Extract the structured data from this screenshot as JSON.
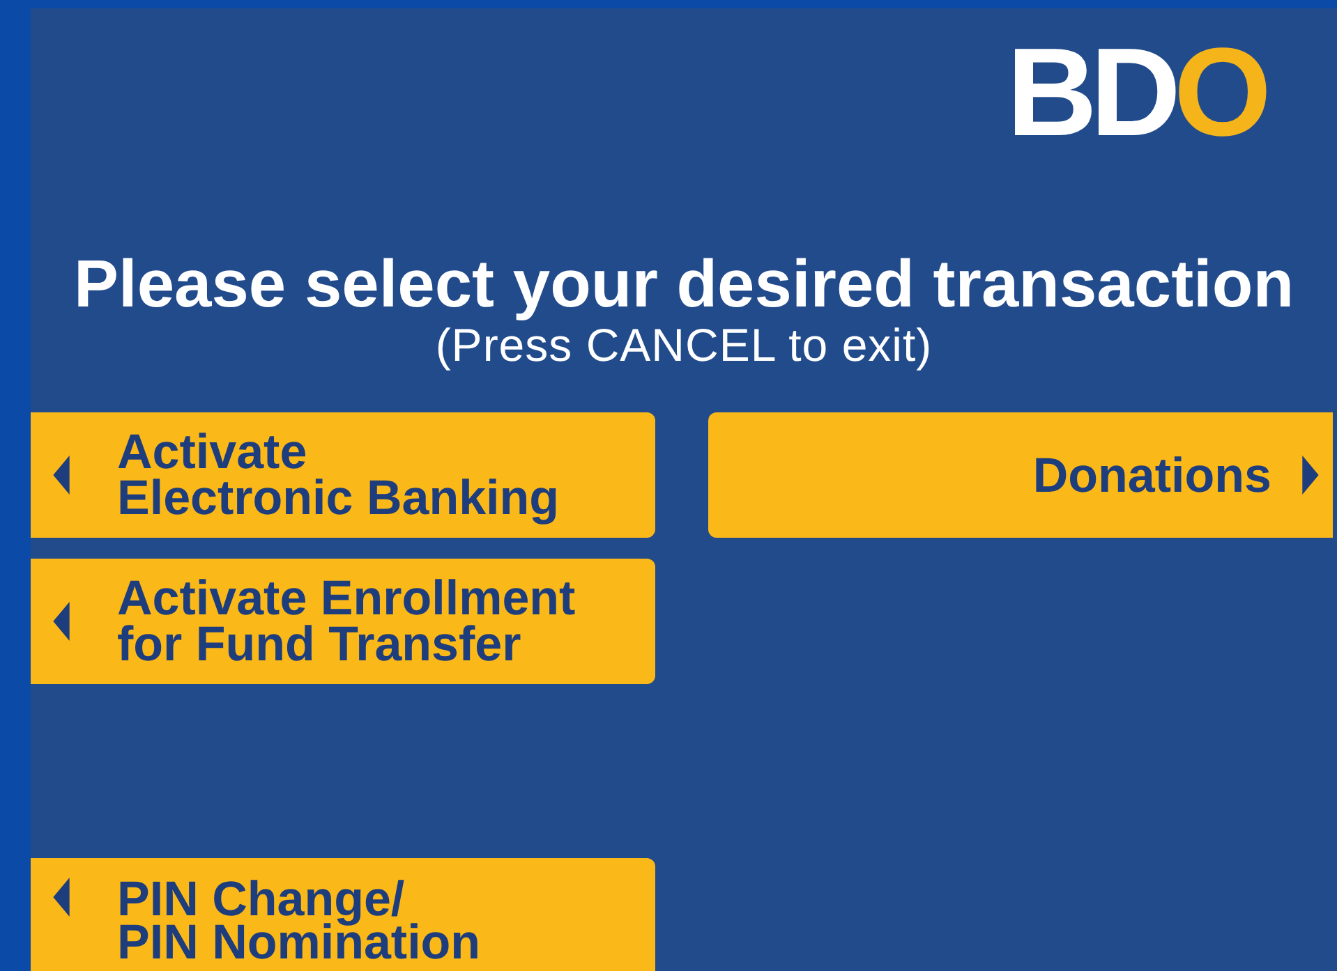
{
  "logo": {
    "white_part": "BD",
    "gold_part": "O"
  },
  "heading": {
    "title": "Please select your desired transaction",
    "subtitle": "(Press CANCEL to exit)"
  },
  "left_options": [
    {
      "label": "Activate\nElectronic Banking",
      "kind": "left-arrow"
    },
    {
      "label": "Activate Enrollment\nfor Fund Transfer",
      "kind": "left-arrow"
    },
    {
      "label": "PIN Change/\nPIN Nomination",
      "kind": "left-arrow"
    }
  ],
  "right_options": [
    {
      "label": "Donations",
      "kind": "right-arrow"
    }
  ]
}
